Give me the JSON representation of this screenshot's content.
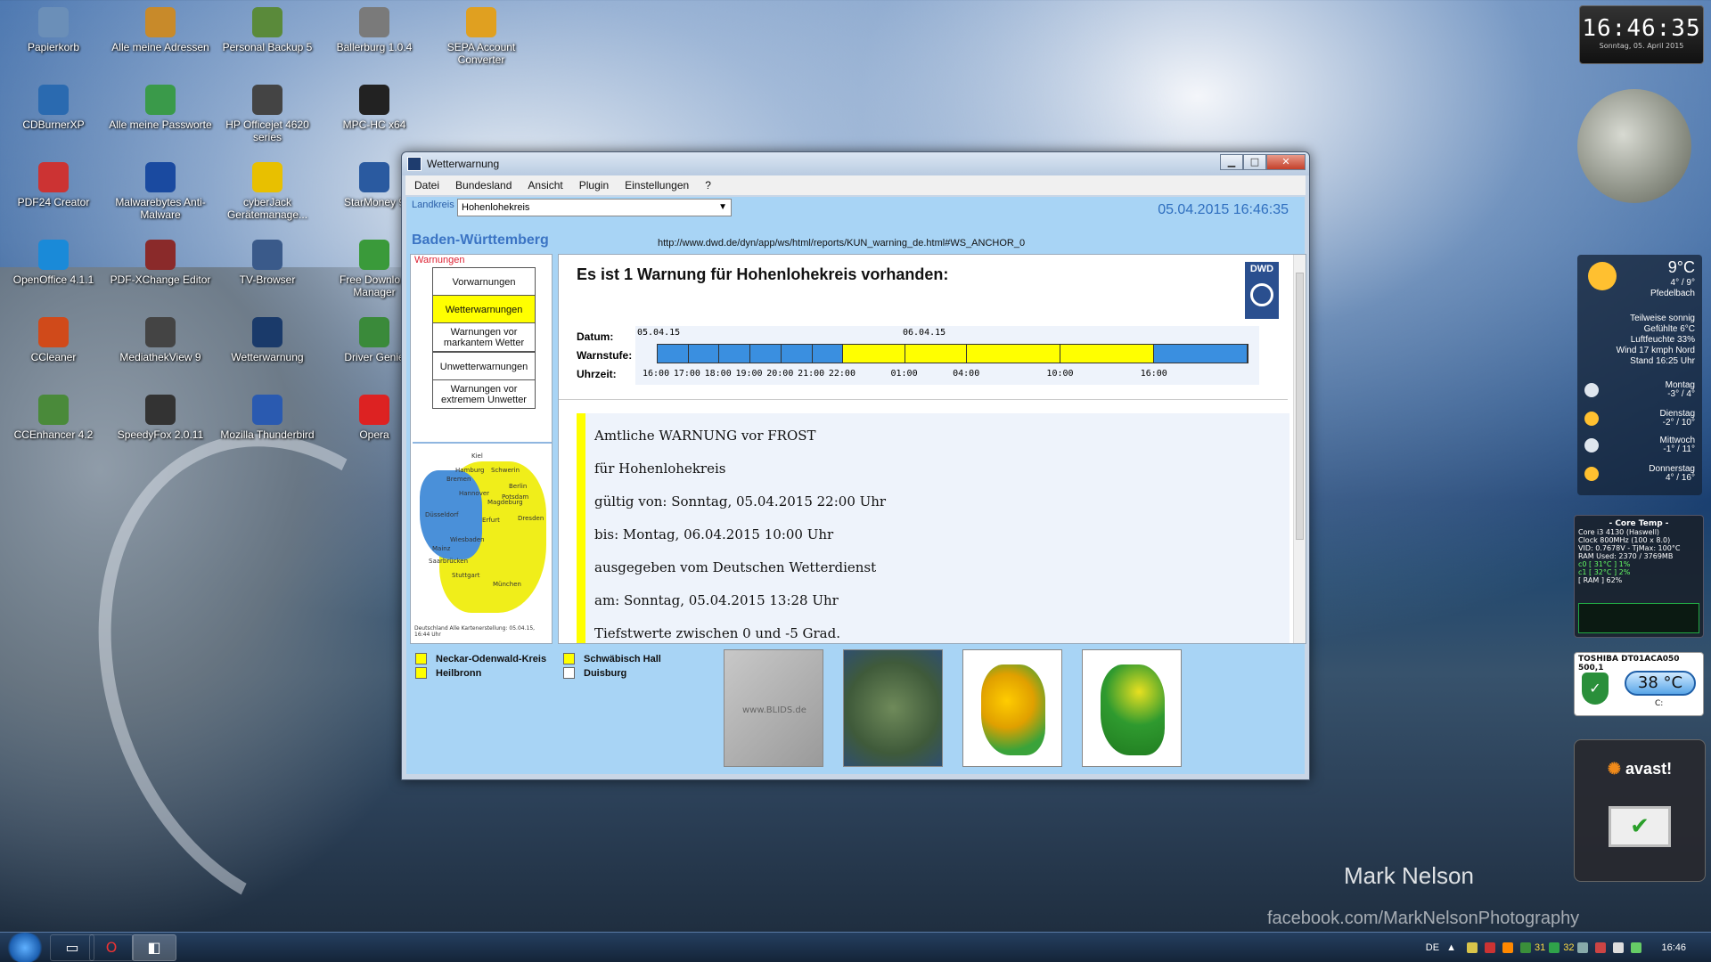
{
  "desktop_icons": [
    {
      "label": "Papierkorb",
      "icon": "recycle-bin-icon"
    },
    {
      "label": "Alle meine Adressen",
      "icon": "address-book-icon"
    },
    {
      "label": "Personal Backup 5",
      "icon": "backup-icon"
    },
    {
      "label": "Ballerburg 1.0.4",
      "icon": "ballerburg-icon"
    },
    {
      "label": "SEPA Account Converter",
      "icon": "sepa-icon"
    },
    {
      "label": "CDBurnerXP",
      "icon": "cd-icon"
    },
    {
      "label": "Alle meine Passworte",
      "icon": "key-icon"
    },
    {
      "label": "HP Officejet 4620 series",
      "icon": "printer-icon"
    },
    {
      "label": "MPC-HC x64",
      "icon": "media-player-icon"
    },
    {
      "label": "PDF24 Creator",
      "icon": "pdf24-icon"
    },
    {
      "label": "Malwarebytes Anti-Malware",
      "icon": "malwarebytes-icon"
    },
    {
      "label": "cyberJack Gerätemanage...",
      "icon": "card-reader-icon"
    },
    {
      "label": "StarMoney 9",
      "icon": "starmoney-icon"
    },
    {
      "label": "OpenOffice 4.1.1",
      "icon": "openoffice-icon"
    },
    {
      "label": "PDF-XChange Editor",
      "icon": "pdf-editor-icon"
    },
    {
      "label": "TV-Browser",
      "icon": "tv-browser-icon"
    },
    {
      "label": "Free Downlo... Manager",
      "icon": "download-manager-icon"
    },
    {
      "label": "CCleaner",
      "icon": "ccleaner-icon"
    },
    {
      "label": "MediathekView 9",
      "icon": "mediathek-icon"
    },
    {
      "label": "Wetterwarnung",
      "icon": "weather-warning-icon"
    },
    {
      "label": "Driver Genie",
      "icon": "driver-genie-icon"
    },
    {
      "label": "CCEnhancer 4.2",
      "icon": "ccenhancer-icon"
    },
    {
      "label": "SpeedyFox 2.0.11",
      "icon": "speedyfox-icon"
    },
    {
      "label": "Mozilla Thunderbird",
      "icon": "thunderbird-icon"
    },
    {
      "label": "Opera",
      "icon": "opera-icon"
    }
  ],
  "window": {
    "title": "Wetterwarnung",
    "menu": [
      "Datei",
      "Bundesland",
      "Ansicht",
      "Plugin",
      "Einstellungen",
      "?"
    ],
    "landkreis_label": "Landkreis",
    "landkreis_value": "Hohenlohekreis",
    "datetime": "05.04.2015 16:46:35",
    "region_title": "Baden-Württemberg",
    "url": "http://www.dwd.de/dyn/app/ws/html/reports/KUN_warning_de.html#WS_ANCHOR_0",
    "warnings_label": "Warnungen",
    "nav_buttons": [
      {
        "label": "Vorwarnungen",
        "active": false
      },
      {
        "label": "Wetterwarnungen",
        "active": true
      },
      {
        "label": "Warnungen vor markantem Wetter",
        "active": false
      },
      {
        "label": "Unwetterwarnungen",
        "active": false
      },
      {
        "label": "Warnungen vor extremem Unwetter",
        "active": false
      }
    ],
    "mini_map": {
      "cities": [
        "Kiel",
        "Hamburg",
        "Schwerin",
        "Bremen",
        "Hannover",
        "Berlin",
        "Potsdam",
        "Magdeburg",
        "Düsseldorf",
        "Erfurt",
        "Dresden",
        "Wiesbaden",
        "Mainz",
        "Saarbrücken",
        "Stuttgart",
        "München"
      ],
      "caption": "Deutschland Alle Kartenerstellung: 05.04.15, 16:44 Uhr"
    },
    "headline": "Es ist 1 Warnung für Hohenlohekreis vorhanden:",
    "dwd_logo": "DWD",
    "timeline": {
      "labels": [
        "Datum:",
        "Warnstufe:",
        "Uhrzeit:"
      ],
      "dates": [
        "05.04.15",
        "06.04.15"
      ],
      "times": [
        "16:00",
        "17:00",
        "18:00",
        "19:00",
        "20:00",
        "21:00",
        "22:00",
        "01:00",
        "04:00",
        "10:00",
        "16:00"
      ],
      "segments": [
        {
          "level": "none",
          "color": "#3a8fe0"
        },
        {
          "level": "none",
          "color": "#3a8fe0"
        },
        {
          "level": "none",
          "color": "#3a8fe0"
        },
        {
          "level": "none",
          "color": "#3a8fe0"
        },
        {
          "level": "none",
          "color": "#3a8fe0"
        },
        {
          "level": "none",
          "color": "#3a8fe0"
        },
        {
          "level": "warning",
          "color": "#ffff00"
        },
        {
          "level": "warning",
          "color": "#ffff00"
        },
        {
          "level": "warning",
          "color": "#ffff00"
        },
        {
          "level": "warning",
          "color": "#ffff00"
        },
        {
          "level": "none",
          "color": "#3a8fe0"
        }
      ]
    },
    "warning_text": [
      "Amtliche WARNUNG vor FROST",
      "für Hohenlohekreis",
      "gültig von: Sonntag, 05.04.2015 22:00 Uhr",
      "bis: Montag, 06.04.2015 10:00 Uhr",
      "ausgegeben vom Deutschen Wetterdienst",
      "am: Sonntag, 05.04.2015 13:28 Uhr",
      "Tiefstwerte zwischen 0 und -5 Grad."
    ],
    "legend": [
      {
        "label": "Neckar-Odenwald-Kreis",
        "color": "#ffff00"
      },
      {
        "label": "Heilbronn",
        "color": "#ffff00"
      },
      {
        "label": "Schwäbisch Hall",
        "color": "#ffff00"
      },
      {
        "label": "Duisburg",
        "color": "#ffffff"
      }
    ],
    "thumbnails": [
      "blitz-map-icon",
      "satellite-map-icon",
      "temperature-map-icon",
      "precipitation-map-icon"
    ],
    "thumbnail_watermark": "www.BLIDS.de"
  },
  "gadgets": {
    "clock_time": "16:46:35",
    "clock_date": "Sonntag, 05. April 2015",
    "weather": {
      "temp": "9°C",
      "minmax": "4° / 9°",
      "place": "Pfedelbach",
      "condition": [
        "Teilweise sonnig",
        "Gefühlte 6°C",
        "Luftfeuchte 33%",
        "Wind 17 kmph Nord",
        "Stand 16:25 Uhr"
      ],
      "forecast": [
        {
          "day": "Montag",
          "range": "-3° / 4°"
        },
        {
          "day": "Dienstag",
          "range": "-2° / 10°"
        },
        {
          "day": "Mittwoch",
          "range": "-1° / 11°"
        },
        {
          "day": "Donnerstag",
          "range": "4° / 16°"
        }
      ]
    },
    "coretemp": {
      "title": "- Core Temp -",
      "lines": [
        "Core i3 4130 (Haswell)",
        "Clock 800MHz (100 x 8.0)",
        "VID: 0.7678V - TjMax: 100°C",
        "RAM Used: 2370 / 3769MB",
        "c0 [ 31°C ] 1%",
        "c1 [ 32°C ] 2%",
        "[ RAM ] 62%"
      ]
    },
    "hdd": {
      "title": "TOSHIBA DT01ACA050 500,1",
      "temp": "38 °C",
      "drive": "C:"
    },
    "avast": "avast!"
  },
  "watermarks": [
    "Mark Nelson",
    "facebook.com/MarkNelsonPhotography"
  ],
  "taskbar": {
    "items": [
      "explorer-icon",
      "opera-icon",
      "wetterwarnung-icon"
    ],
    "tray_lang": "DE",
    "tray_nums": [
      "31",
      "32"
    ],
    "time": "16:46"
  }
}
